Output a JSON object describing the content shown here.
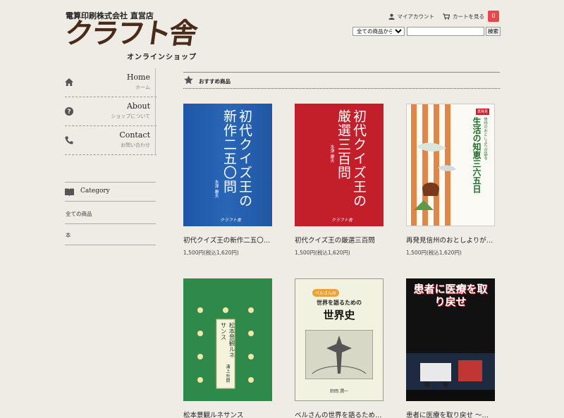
{
  "header": {
    "company": "電算印刷株式会社 直営店",
    "logo": "クラフト舎",
    "logo_sub": "オンラインショップ",
    "my_account": "マイアカウント",
    "view_cart": "カートを見る",
    "cart_count": "0"
  },
  "search": {
    "category_selected": "全ての商品から",
    "button": "検索"
  },
  "nav": [
    {
      "title": "Home",
      "sub": "ホーム"
    },
    {
      "title": "About",
      "sub": "ショップについて"
    },
    {
      "title": "Contact",
      "sub": "お問い合わせ"
    }
  ],
  "category": {
    "title": "Category",
    "items": [
      "全ての商品",
      "本"
    ]
  },
  "section": {
    "title": "おすすめ商品"
  },
  "products": [
    {
      "name": "初代クイズ王の新作二五〇…",
      "price": "1,500円(税込1,620円)",
      "cover_title": "初代クイズ王の新作二五〇問",
      "cover_author": "水津 康夫",
      "cover_pub": "クラフト舎"
    },
    {
      "name": "初代クイズ王の厳選三百問",
      "price": "1,500円(税込1,620円)",
      "cover_title": "初代クイズ王の厳選三百問",
      "cover_author": "水津 康夫",
      "cover_pub": "クラフト舎"
    },
    {
      "name": "再発見信州のおとしよりが…",
      "price": "1,500円(税込1,620円)",
      "cover_title": "生活の知恵三六五日",
      "cover_subtitle": "信州のおとしよりが語る",
      "cover_badge": "再発見"
    },
    {
      "name": "松本景観ルネサンス",
      "cover_title": "松本景観ルネサンス",
      "cover_author": "溝上 哲朗"
    },
    {
      "name": "ベルさんの世界を語るため…",
      "cover_title": "世界史",
      "cover_subtitle": "世界を語るための",
      "cover_badge": "ベルさんの",
      "cover_author": "鈴岡 潤一"
    },
    {
      "name": "患者に医療を取り戻せ 〜…",
      "cover_title": "患者に医療を取り戻せ"
    }
  ],
  "colors": {
    "cart_badge": "#e8484a",
    "background": "#efece6",
    "logo": "#4a2a18"
  }
}
